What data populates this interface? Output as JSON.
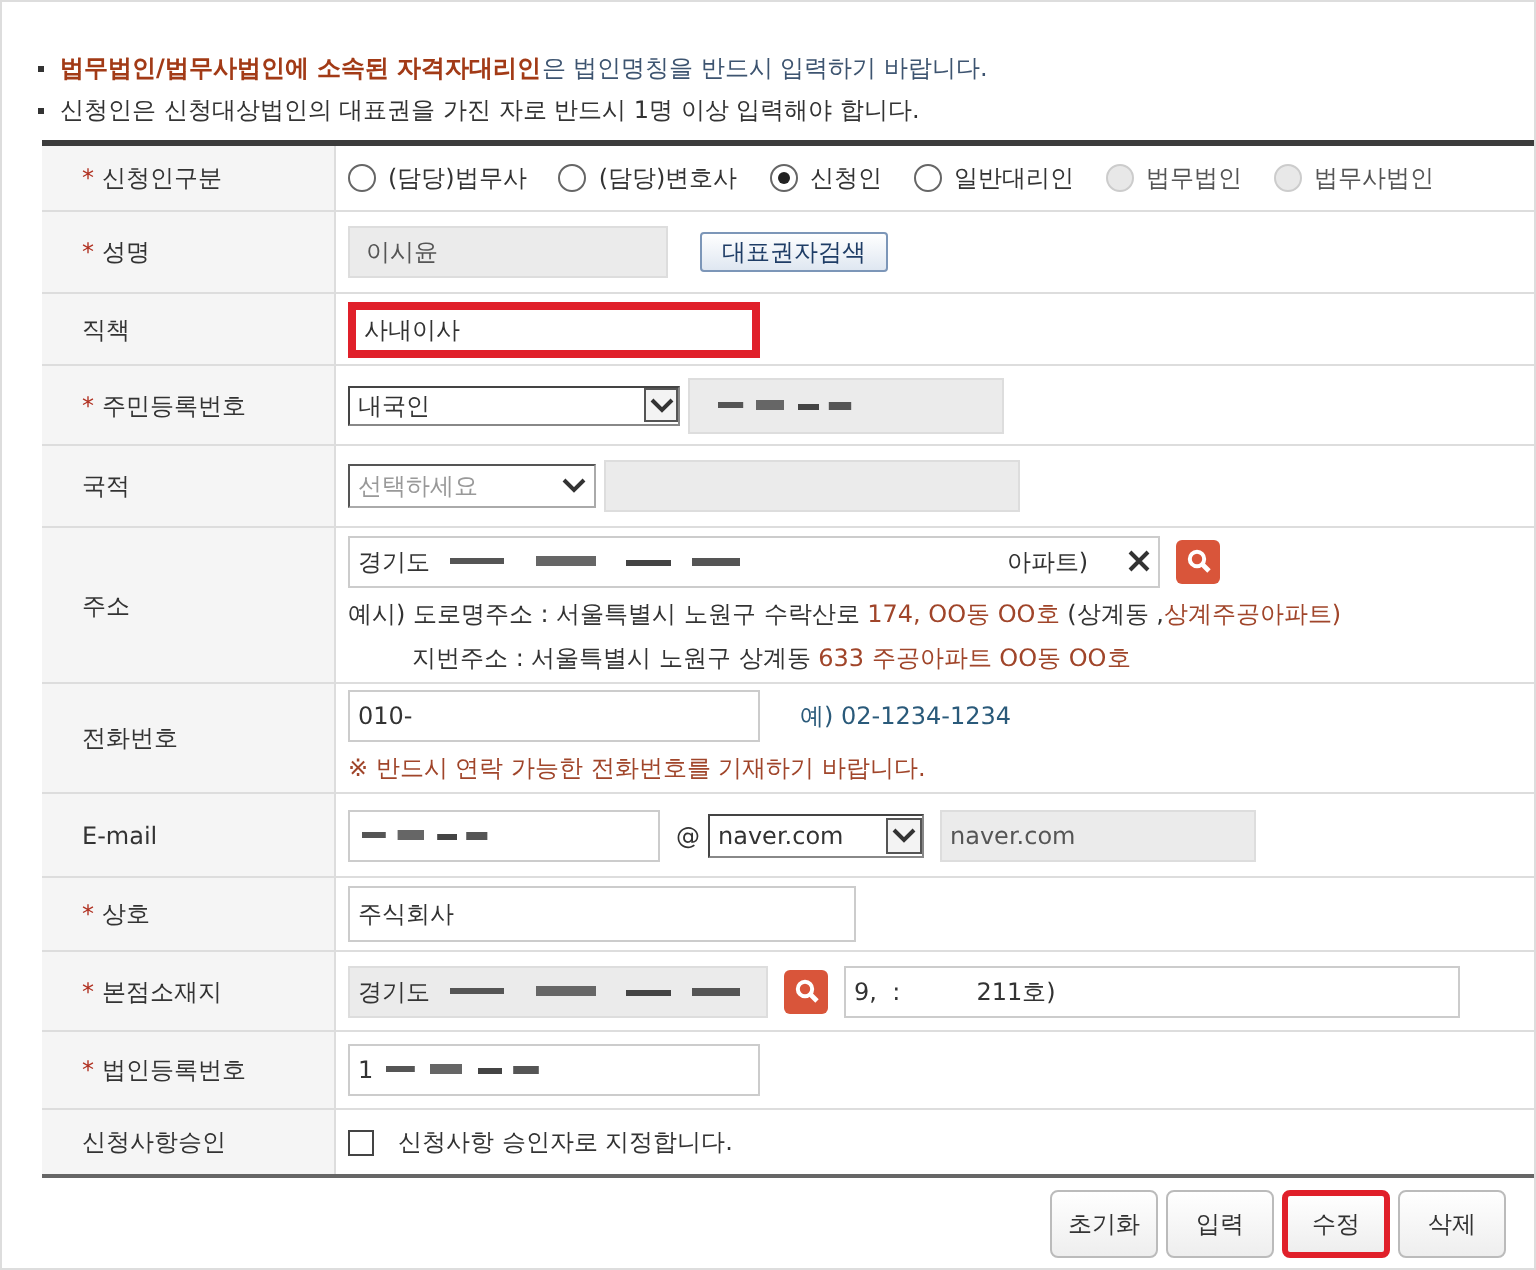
{
  "notices": [
    "**법무법인/법무사법인에 소속된 자격자대리인**은 법인명칭을 반드시 입력하기 바랍니다.",
    "신청인은 신청대상법인의 대표권을 가진 자로 반드시 1명 이상 입력해야 합니다."
  ],
  "rows": [
    {
      "kind": "radio",
      "label": "신청인구분",
      "required_mark": "*",
      "options": [
        {
          "label": "(담당)법무사",
          "selected": false,
          "disabled": false
        },
        {
          "label": "(담당)변호사",
          "selected": false,
          "disabled": false
        },
        {
          "label": "신청인",
          "selected": true,
          "disabled": false
        },
        {
          "label": "일반대리인",
          "selected": false,
          "disabled": false
        },
        {
          "label": "법무법인",
          "selected": false,
          "disabled": true
        },
        {
          "label": "법무사법인",
          "selected": false,
          "disabled": true
        }
      ]
    },
    {
      "kind": "name",
      "label": "성명",
      "required_mark": "*",
      "value": "이시윤",
      "button": "대표권자검색"
    },
    {
      "kind": "text",
      "label": "직책",
      "value": "사내이사",
      "highlighted": true
    },
    {
      "kind": "id",
      "label": "주민등록번호",
      "required_mark": "*",
      "select": "내국인",
      "redacted": true
    },
    {
      "kind": "nationality",
      "label": "국적",
      "placeholder": "선택하세요"
    },
    {
      "kind": "address",
      "label": "주소",
      "value_start": "경기도",
      "value_end": "아파트)",
      "redacted": true,
      "examples": [
        "예시) 도로명주소 : 서울특별시 노원구 수락산로 **174, OO동 OO호** (상계동 ,**상계주공아파트)**",
        "지번주소 : 서울특별시 노원구 상계동 **633 주공아파트 OO동 OO호**"
      ]
    },
    {
      "kind": "phone",
      "label": "전화번호",
      "value": "010-",
      "example": "예) 02-1234-1234",
      "notice": "※ 반드시 연락 가능한 전화번호를 기재하기 바랍니다."
    },
    {
      "kind": "email",
      "label": "E-mail",
      "redacted": true,
      "at": "@",
      "select": "naver.com",
      "domain": "naver.com"
    },
    {
      "kind": "text",
      "label": "상호",
      "required_mark": "*",
      "value": "주식회사",
      "highlighted": false
    },
    {
      "kind": "office",
      "label": "본점소재지",
      "required_mark": "*",
      "value": "경기도",
      "redacted": true,
      "detail": "9,  :          211호)"
    },
    {
      "kind": "regno",
      "label": "법인등록번호",
      "required_mark": "*",
      "value": "1",
      "redacted": true
    },
    {
      "kind": "checkbox",
      "label": "신청사항승인",
      "checkbox_label": "신청사항 승인자로 지정합니다.",
      "checked": false
    }
  ],
  "buttons": [
    {
      "label": "초기화",
      "highlighted": false
    },
    {
      "label": "입력",
      "highlighted": false
    },
    {
      "label": "수정",
      "highlighted": true
    },
    {
      "label": "삭제",
      "highlighted": false
    }
  ]
}
